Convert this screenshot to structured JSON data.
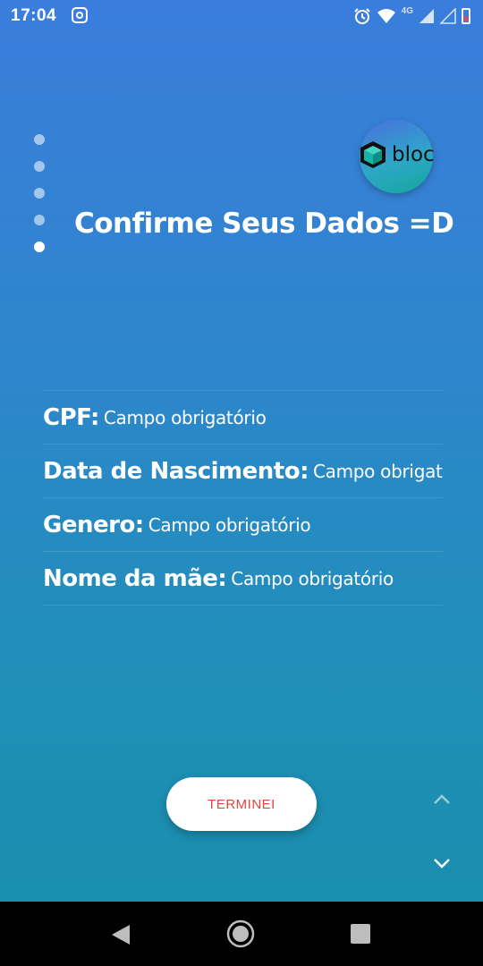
{
  "status_bar": {
    "time": "17:04",
    "network": "4G",
    "icons": [
      "instagram-icon",
      "alarm-icon",
      "wifi-icon",
      "signal-icon",
      "battery-icon"
    ]
  },
  "pager": {
    "total_pages": 5,
    "active_page": 5
  },
  "logo": {
    "text": "bloc",
    "icon": "cube-icon"
  },
  "title": "Confirme Seus Dados =D",
  "fields": [
    {
      "label": "CPF:",
      "value": "Campo obrigatório"
    },
    {
      "label": "Data de Nascimento:",
      "value": "Campo obrigatório"
    },
    {
      "label": "Genero:",
      "value": "Campo obrigatório"
    },
    {
      "label": "Nome da mãe:",
      "value": "Campo obrigatório"
    }
  ],
  "done_button": {
    "label": "TERMINEI"
  },
  "navigation": {
    "up_icon": "chevron-up-icon",
    "down_icon": "chevron-down-icon"
  },
  "system_nav": {
    "back": "back-icon",
    "home": "home-icon",
    "recents": "recents-icon"
  },
  "colors": {
    "background_top": "#3b7ddc",
    "background_bottom": "#1a8eae",
    "button_text": "#e0463a"
  }
}
